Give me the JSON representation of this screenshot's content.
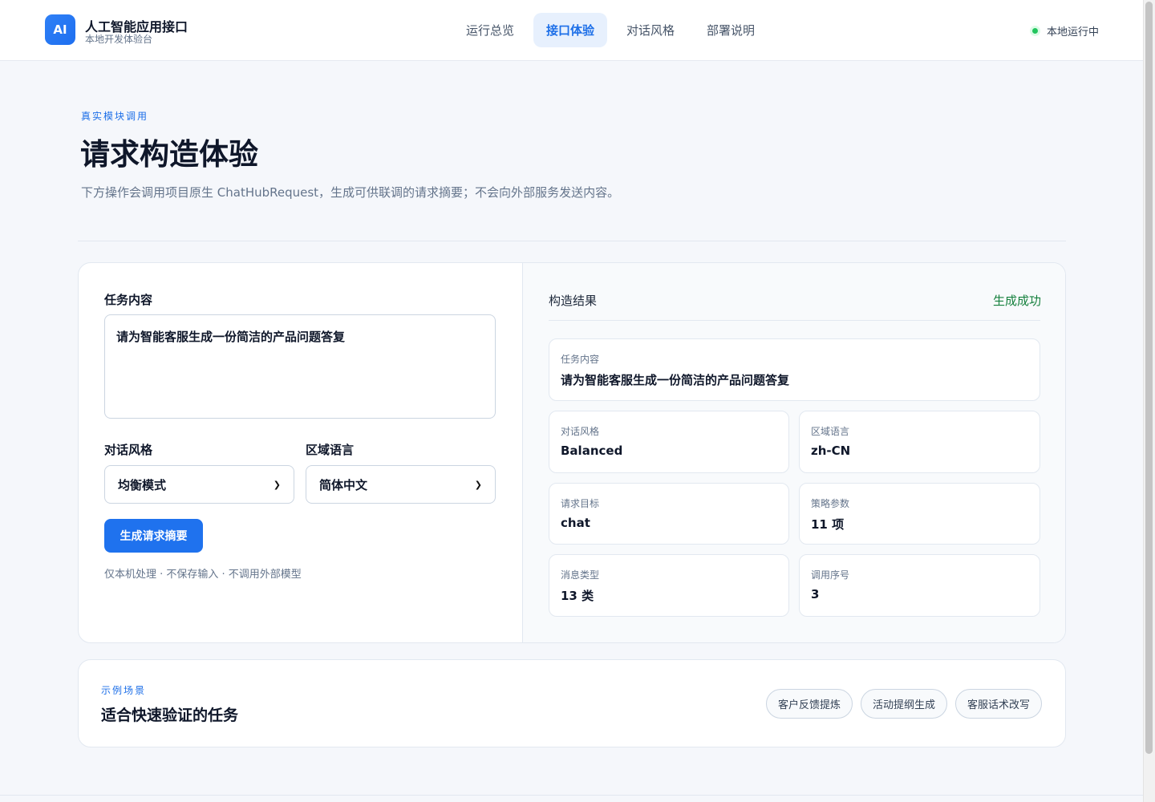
{
  "header": {
    "logo": "AI",
    "title": "人工智能应用接口",
    "subtitle": "本地开发体验台",
    "nav": [
      {
        "label": "运行总览"
      },
      {
        "label": "接口体验"
      },
      {
        "label": "对话风格"
      },
      {
        "label": "部署说明"
      }
    ],
    "active_nav": "接口体验",
    "status": "本地运行中",
    "status_color": "#22c55e"
  },
  "hero": {
    "eyebrow": "真实模块调用",
    "title": "请求构造体验",
    "description": "下方操作会调用项目原生 ChatHubRequest，生成可供联调的请求摘要；不会向外部服务发送内容。"
  },
  "form": {
    "task_label": "任务内容",
    "task_value": "请为智能客服生成一份简洁的产品问题答复",
    "style_label": "对话风格",
    "style_value": "均衡模式",
    "locale_label": "区域语言",
    "locale_value": "简体中文",
    "submit_label": "生成请求摘要",
    "hint": "仅本机处理 · 不保存输入 · 不调用外部模型"
  },
  "result": {
    "title": "构造结果",
    "status": "生成成功",
    "status_color": "#15803d",
    "task": {
      "key": "任务内容",
      "value": "请为智能客服生成一份简洁的产品问题答复"
    },
    "items": [
      {
        "key": "对话风格",
        "value": "Balanced"
      },
      {
        "key": "区域语言",
        "value": "zh-CN"
      },
      {
        "key": "请求目标",
        "value": "chat"
      },
      {
        "key": "策略参数",
        "value": "11 项"
      },
      {
        "key": "消息类型",
        "value": "13 类"
      },
      {
        "key": "调用序号",
        "value": "3"
      }
    ]
  },
  "scenarios": {
    "eyebrow": "示例场景",
    "title": "适合快速验证的任务",
    "chips": [
      {
        "label": "客户反馈提炼"
      },
      {
        "label": "活动提纲生成"
      },
      {
        "label": "客服话术改写"
      }
    ]
  },
  "accent_color": "#1f72ee"
}
